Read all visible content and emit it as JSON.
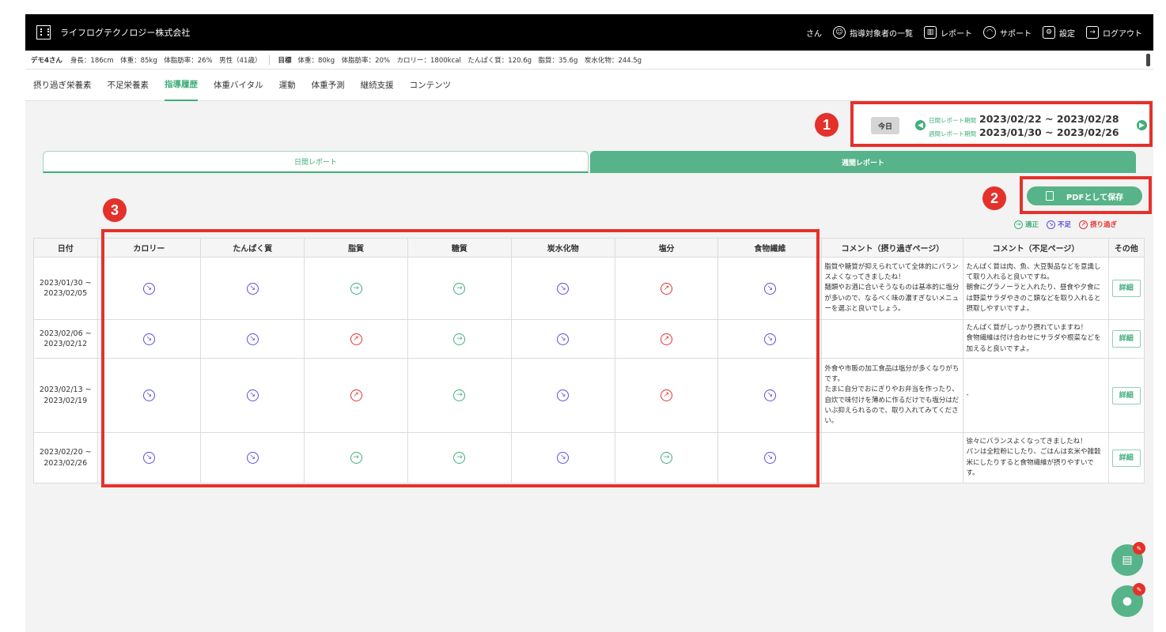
{
  "header": {
    "company": "ライフログテクノロジー株式会社",
    "user_suffix": "さん",
    "nav": [
      {
        "label": "指導対象者の一覧",
        "icon": "user-circle-icon"
      },
      {
        "label": "レポート",
        "icon": "chart-icon"
      },
      {
        "label": "サポート",
        "icon": "headset-icon"
      },
      {
        "label": "設定",
        "icon": "gear-icon"
      },
      {
        "label": "ログアウト",
        "icon": "logout-icon"
      }
    ]
  },
  "info": {
    "name": "デモ4さん",
    "details": "身長：186cm　体重：85kg　体脂肪率：26%　男性（41歳）",
    "goal_label": "目標",
    "goal_details": "体重：80kg　体脂肪率：20%　カロリー：1800kcal　たんぱく質：120.6g　脂質：35.6g　炭水化物：244.5g"
  },
  "tabs": [
    {
      "label": "摂り過ぎ栄養素"
    },
    {
      "label": "不足栄養素"
    },
    {
      "label": "指導履歴",
      "active": true
    },
    {
      "label": "体重バイタル"
    },
    {
      "label": "運動"
    },
    {
      "label": "体重予測"
    },
    {
      "label": "継続支援"
    },
    {
      "label": "コンテンツ"
    }
  ],
  "period": {
    "today_label": "今日",
    "daily_label": "日間レポート期間",
    "daily_range": "2023/02/22 ~ 2023/02/28",
    "weekly_label": "週間レポート期間",
    "weekly_range": "2023/01/30 ~ 2023/02/26"
  },
  "report_tabs": {
    "daily": "日間レポート",
    "weekly": "週間レポート"
  },
  "pdf_button": "PDFとして保存",
  "legend": {
    "ok": "適正",
    "low": "不足",
    "over": "摂り過ぎ"
  },
  "markers": {
    "m1": "1",
    "m2": "2",
    "m3": "3"
  },
  "table": {
    "headers": [
      "日付",
      "カロリー",
      "たんぱく質",
      "脂質",
      "糖質",
      "炭水化物",
      "塩分",
      "食物繊維",
      "コメント（摂り過ぎページ）",
      "コメント（不足ページ）",
      "その他"
    ],
    "detail_label": "詳細",
    "rows": [
      {
        "date": "2023/01/30 ~\n2023/02/05",
        "status": [
          "low",
          "low",
          "ok",
          "ok",
          "low",
          "over",
          "low"
        ],
        "comment_over": "脂質や糖質が抑えられていて全体的にバランスよくなってきましたね！\n麺類やお酒に合いそうなものは基本的に塩分が多いので、なるべく味の濃すぎないメニューを選ぶと良いでしょう。",
        "comment_low": "たんぱく質は肉、魚、大豆製品などを意識して取り入れると良いですね。\n朝食にグラノーラと入れたり、昼食や夕食には野菜サラダやきのこ類などを取り入れると摂取しやすいですよ。"
      },
      {
        "date": "2023/02/06 ~\n2023/02/12",
        "status": [
          "low",
          "low",
          "over",
          "ok",
          "low",
          "over",
          "low"
        ],
        "comment_over": "",
        "comment_low": "たんぱく質がしっかり摂れていますね！\n食物繊維は付け合わせにサラダや根菜などを加えると良いですよ。"
      },
      {
        "date": "2023/02/13 ~\n2023/02/19",
        "status": [
          "low",
          "low",
          "over",
          "ok",
          "low",
          "over",
          "low"
        ],
        "comment_over": "外食や市販の加工食品は塩分が多くなりがちです。\nたまに自分でおにぎりやお弁当を作ったり、自炊で味付けを薄めに作るだけでも塩分はだいぶ抑えられるので、取り入れてみてください。",
        "comment_low": "-"
      },
      {
        "date": "2023/02/20 ~\n2023/02/26",
        "status": [
          "low",
          "low",
          "ok",
          "ok",
          "low",
          "ok",
          "low"
        ],
        "comment_over": "",
        "comment_low": "徐々にバランスよくなってきましたね！\nパンは全粒粉にしたり、ごはんは玄米や雑穀米にしたりすると食物繊維が摂りやすいです。"
      }
    ]
  },
  "accent": "#3fae7a",
  "highlight": "#e5312b"
}
